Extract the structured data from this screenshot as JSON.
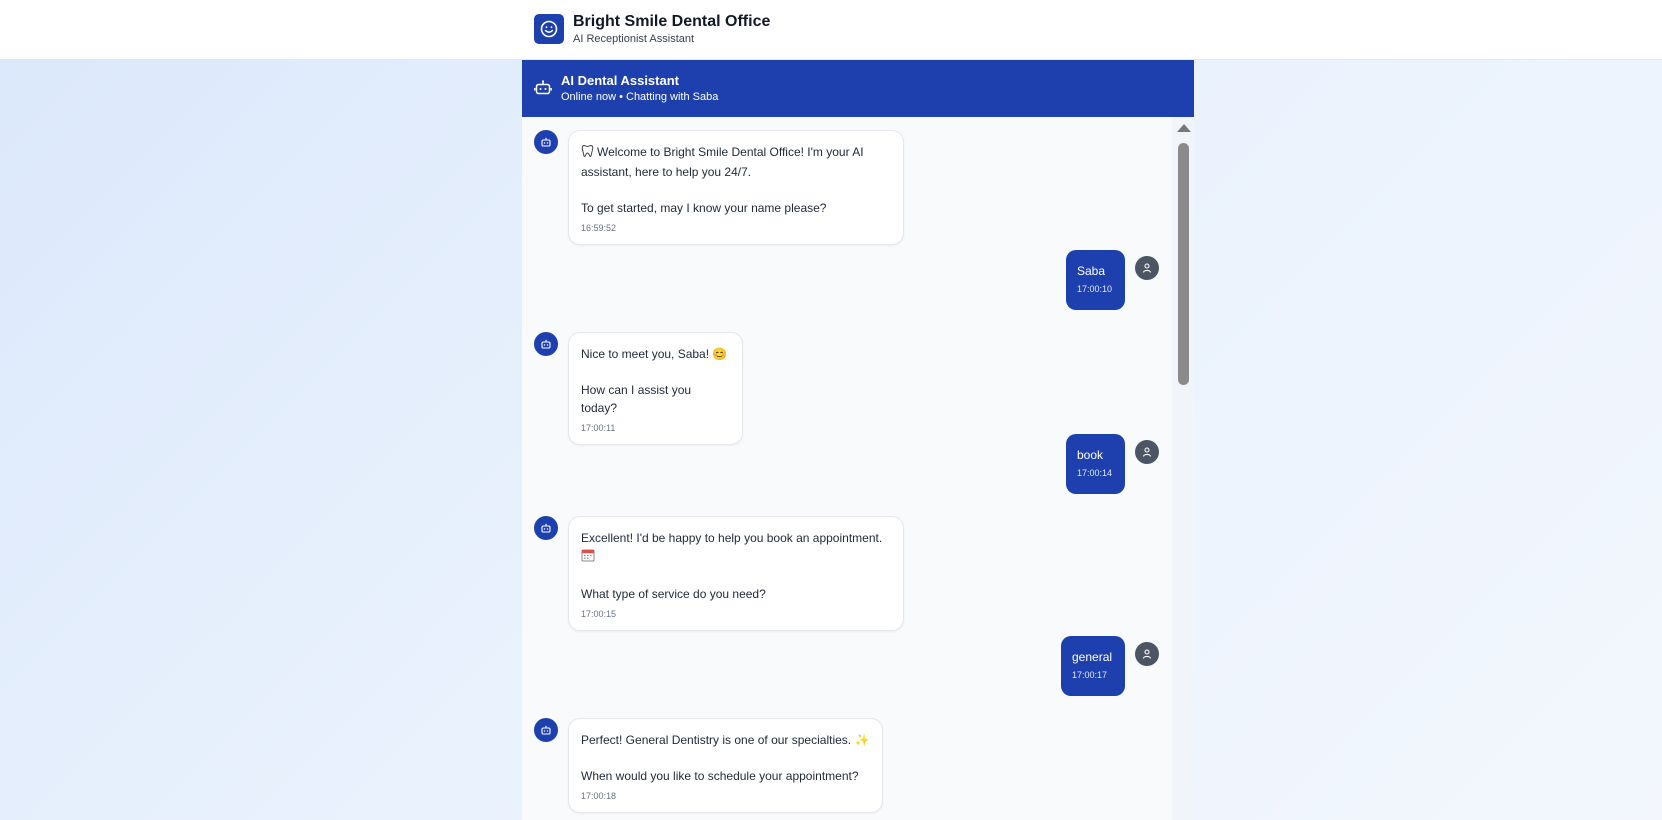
{
  "brand": {
    "title": "Bright Smile Dental Office",
    "subtitle": "AI Receptionist Assistant"
  },
  "chat_header": {
    "title": "AI Dental Assistant",
    "status": "Online now • Chatting with Saba"
  },
  "messages": [
    {
      "sender": "bot",
      "line1": "Welcome to Bright Smile Dental Office! I'm your AI assistant, here to help you 24/7.",
      "line2": "To get started, may I know your name please?",
      "time": "16:59:52",
      "icon": "tooth-icon"
    },
    {
      "sender": "user",
      "text": "Saba",
      "time": "17:00:10"
    },
    {
      "sender": "bot",
      "line1": "Nice to meet you, Saba! 😊",
      "line2": "How can I assist you today?",
      "time": "17:00:11"
    },
    {
      "sender": "user",
      "text": "book",
      "time": "17:00:14"
    },
    {
      "sender": "bot",
      "line1": "Excellent! I'd be happy to help you book an appointment.",
      "line1_icon": "calendar-icon",
      "line2": "What type of service do you need?",
      "time": "17:00:15"
    },
    {
      "sender": "user",
      "text": "general",
      "time": "17:00:17"
    },
    {
      "sender": "bot",
      "line1": "Perfect! General Dentistry is one of our specialties. ✨",
      "line2": "When would you like to schedule your appointment?",
      "time": "17:00:18"
    }
  ],
  "colors": {
    "primary": "#1e40af",
    "user_avatar": "#4b5563",
    "chat_bg": "#f8fafc"
  }
}
